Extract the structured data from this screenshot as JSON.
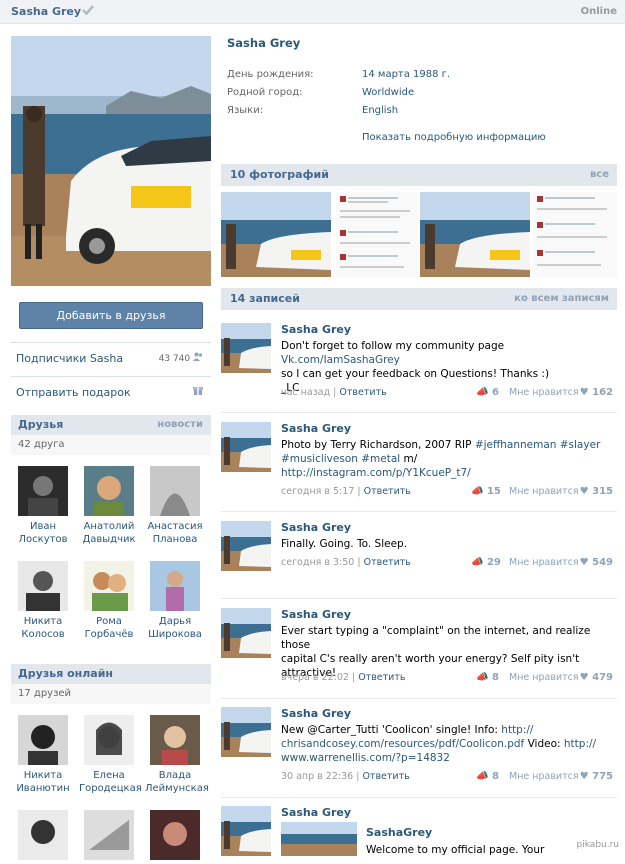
{
  "header": {
    "name": "Sasha Grey",
    "status": "Online"
  },
  "profile": {
    "name": "Sasha Grey",
    "info": [
      {
        "label": "День рождения:",
        "value": "14 марта 1988 г."
      },
      {
        "label": "Родной город:",
        "value": "Worldwide"
      },
      {
        "label": "Языки:",
        "value": "English"
      }
    ],
    "more_link": "Показать подробную информацию"
  },
  "left": {
    "add_friend": "Добавить в друзья",
    "subscribers_label": "Подписчики Sasha",
    "subscribers_count": "43 740",
    "gift_label": "Отправить подарок",
    "friends_title": "Друзья",
    "friends_news": "новости",
    "friends_count": "42 друга",
    "friends": [
      {
        "first": "Иван",
        "last": "Лоскутов"
      },
      {
        "first": "Анатолий",
        "last": "Давыдчик"
      },
      {
        "first": "Анастасия",
        "last": "Планова"
      },
      {
        "first": "Никита",
        "last": "Колосов"
      },
      {
        "first": "Рома",
        "last": "Горбачёв"
      },
      {
        "first": "Дарья",
        "last": "Широкова"
      }
    ],
    "online_title": "Друзья онлайн",
    "online_count": "17 друзей",
    "online": [
      {
        "first": "Никита",
        "last": "Иванютин"
      },
      {
        "first": "Елена",
        "last": "Городецкая"
      },
      {
        "first": "Влада",
        "last": "Леймунская"
      }
    ]
  },
  "photos": {
    "title": "10 фотографий",
    "all": "все"
  },
  "wall": {
    "title": "14 записей",
    "all": "ко всем записям",
    "like_label": "Мне нравится",
    "reply_label": "Ответить",
    "posts": [
      {
        "author": "Sasha Grey",
        "line1a": "Don't forget to follow my community page ",
        "line1b": "Vk.com/IamSashaGrey",
        "line2": "so I can get your feedback on Questions! Thanks :)",
        "line3": "_LC",
        "time": "час назад",
        "shares": "6",
        "likes": "162"
      },
      {
        "author": "Sasha Grey",
        "line1a": "Photo by Terry Richardson, 2007 RIP ",
        "line1b": "#jeffhanneman #slayer",
        "line2a": "#musicliveson #metal",
        "line2b": " m/",
        "line3": "http://instagram.com/p/Y1KcueP_t7/",
        "time": "сегодня в 5:17",
        "shares": "15",
        "likes": "315"
      },
      {
        "author": "Sasha Grey",
        "line1": "Finally. Going. To. Sleep.",
        "time": "сегодня в 3:50",
        "shares": "29",
        "likes": "549"
      },
      {
        "author": "Sasha Grey",
        "line1": "Ever start typing a \"complaint\" on the internet, and realize those",
        "line2": "capital C's really aren't worth your energy? Self pity isn't",
        "line3": "attractive!",
        "time": "вчера в 22:02",
        "shares": "8",
        "likes": "479"
      },
      {
        "author": "Sasha Grey",
        "line1a": "New @Carter_Tutti 'Coolicon' single! Info: ",
        "line1b": "http://",
        "line2a": "chrisandcosey.com/resources/pdf/Coolicon.pdf",
        "line2b": " Video: ",
        "line2c": "http://",
        "line3": "www.warrenellis.com/?p=14832",
        "time": "30 апр в 22:36",
        "shares": "8",
        "likes": "775"
      },
      {
        "author": "Sasha Grey",
        "repost_name": "SashaGrey",
        "repost_text": "Welcome to my official page. Your"
      }
    ]
  },
  "watermark": "pikabu.ru",
  "colors": {
    "link": "#2b587a",
    "header_bg": "#e1e7ed",
    "button": "#5e82a8"
  }
}
